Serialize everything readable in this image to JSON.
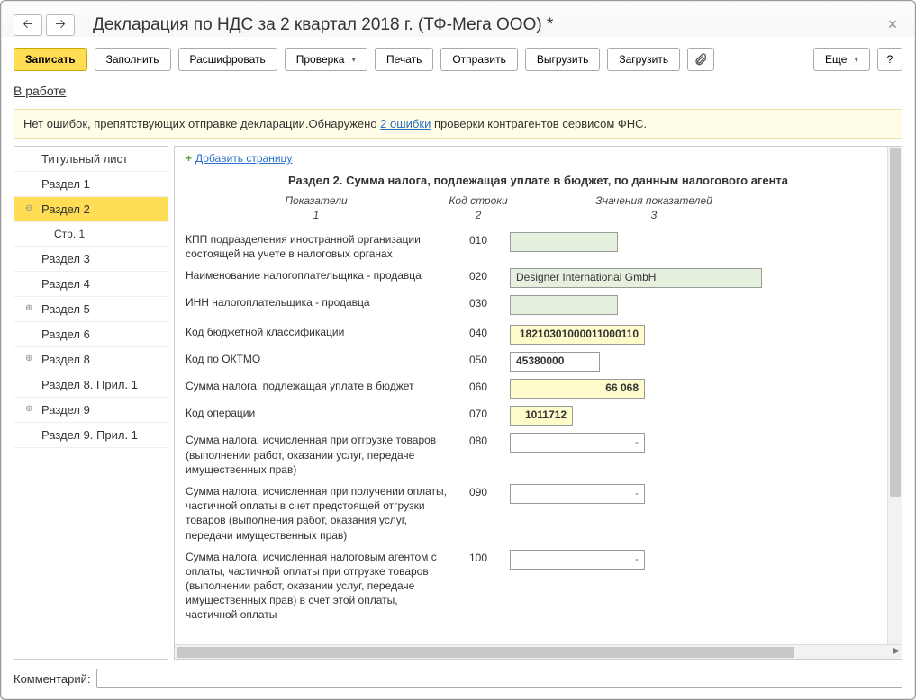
{
  "title": "Декларация по НДС за 2 квартал 2018 г. (ТФ-Мега ООО) *",
  "toolbar": {
    "record": "Записать",
    "fill": "Заполнить",
    "decode": "Расшифровать",
    "check": "Проверка",
    "print": "Печать",
    "send": "Отправить",
    "upload": "Выгрузить",
    "download": "Загрузить",
    "more": "Еще",
    "help": "?"
  },
  "status": "В работе",
  "notice": {
    "pre": "Нет ошибок, препятствующих отправке декларации.Обнаружено ",
    "link": "2 ошибки",
    "post": " проверки контрагентов сервисом ФНС."
  },
  "tree": [
    {
      "label": "Титульный лист",
      "expander": ""
    },
    {
      "label": "Раздел 1",
      "expander": ""
    },
    {
      "label": "Раздел 2",
      "expander": "⊖",
      "selected": true
    },
    {
      "label": "Стр. 1",
      "expander": "",
      "level1": true
    },
    {
      "label": "Раздел 3",
      "expander": ""
    },
    {
      "label": "Раздел 4",
      "expander": ""
    },
    {
      "label": "Раздел 5",
      "expander": "⊕"
    },
    {
      "label": "Раздел 6",
      "expander": ""
    },
    {
      "label": "Раздел 8",
      "expander": "⊕"
    },
    {
      "label": "Раздел 8. Прил. 1",
      "expander": ""
    },
    {
      "label": "Раздел 9",
      "expander": "⊕"
    },
    {
      "label": "Раздел 9. Прил. 1",
      "expander": ""
    }
  ],
  "addPage": "Добавить страницу",
  "sectionTitle": "Раздел 2. Сумма налога, подлежащая уплате в бюджет, по данным налогового агента",
  "headers": {
    "c1": "Показатели",
    "c2": "Код строки",
    "c3": "Значения показателей",
    "s1": "1",
    "s2": "2",
    "s3": "3"
  },
  "rows": [
    {
      "label": "КПП подразделения иностранной организации, состоящей на учете в налоговых органах",
      "code": "010",
      "val": "",
      "cls": "fld-green w120"
    },
    {
      "label": "Наименование налогоплательщика - продавца",
      "code": "020",
      "val": "Designer International GmbH",
      "cls": "fld-green w280"
    },
    {
      "label": "ИНН налогоплательщика - продавца",
      "code": "030",
      "val": "",
      "cls": "fld-green w120"
    },
    {
      "label": "Код бюджетной классификации",
      "code": "040",
      "val": "18210301000011000110",
      "cls": "fld-yellow w150",
      "bold": true
    },
    {
      "label": "Код по ОКТМО",
      "code": "050",
      "val": "45380000",
      "cls": "w100",
      "bold": true
    },
    {
      "label": "Сумма налога, подлежащая уплате в бюджет",
      "code": "060",
      "val": "66 068",
      "cls": "fld-yellow fld-num w150",
      "bold": true
    },
    {
      "label": "Код операции",
      "code": "070",
      "val": "1011712",
      "cls": "fld-yellow w70",
      "bold": true
    },
    {
      "label": "Сумма налога, исчисленная при отгрузке товаров (выполнении работ, оказании услуг, передаче имущественных прав)",
      "code": "080",
      "val": "-",
      "cls": "fld-num fld-dash w150"
    },
    {
      "label": "Сумма налога, исчисленная при получении оплаты, частичной оплаты в счет предстоящей отгрузки товаров (выполнения работ, оказания услуг, передачи имущественных прав)",
      "code": "090",
      "val": "-",
      "cls": "fld-num fld-dash w150"
    },
    {
      "label": "Сумма налога, исчисленная налоговым агентом с оплаты, частичной оплаты при отгрузке товаров (выполнении работ, оказании услуг, передаче имущественных прав) в счет этой оплаты, частичной оплаты",
      "code": "100",
      "val": "-",
      "cls": "fld-num fld-dash w150"
    }
  ],
  "commentLabel": "Комментарий:",
  "commentValue": ""
}
